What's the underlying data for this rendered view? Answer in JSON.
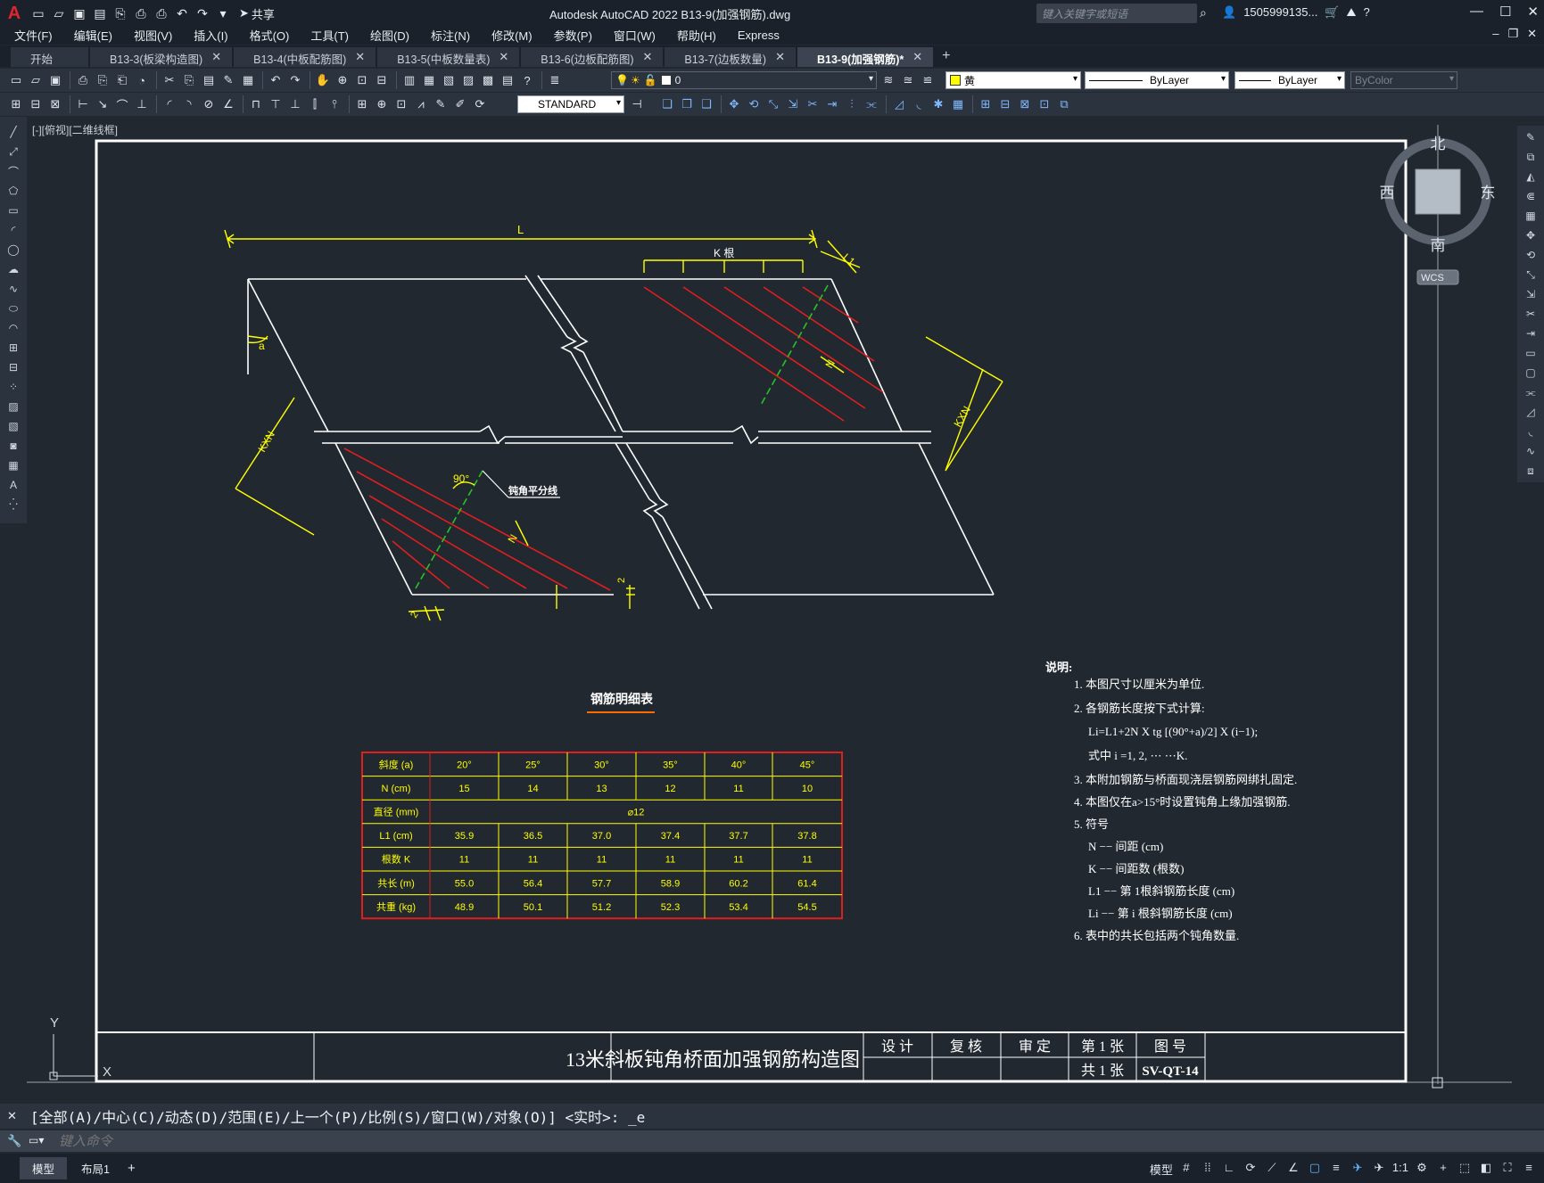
{
  "app": {
    "window_title": "Autodesk AutoCAD 2022    B13-9(加强钢筋).dwg",
    "share_label": "共享",
    "search_placeholder": "键入关键字或短语",
    "user": "1505999135...",
    "logo": "A"
  },
  "menu": [
    "文件(F)",
    "编辑(E)",
    "视图(V)",
    "插入(I)",
    "格式(O)",
    "工具(T)",
    "绘图(D)",
    "标注(N)",
    "修改(M)",
    "参数(P)",
    "窗口(W)",
    "帮助(H)",
    "Express"
  ],
  "tabs": [
    {
      "label": "开始",
      "closable": false,
      "active": false
    },
    {
      "label": "B13-3(板梁构造图)",
      "closable": true,
      "active": false
    },
    {
      "label": "B13-4(中板配筋图)",
      "closable": true,
      "active": false
    },
    {
      "label": "B13-5(中板数量表)",
      "closable": true,
      "active": false
    },
    {
      "label": "B13-6(边板配筋图)",
      "closable": true,
      "active": false
    },
    {
      "label": "B13-7(边板数量)",
      "closable": true,
      "active": false
    },
    {
      "label": "B13-9(加强钢筋)*",
      "closable": true,
      "active": true
    }
  ],
  "toolbar": {
    "layer_value": "0",
    "color_value": "黄",
    "color_hex": "#ffff00",
    "linetype_value": "ByLayer",
    "lineweight_value": "ByLayer",
    "plotstyle_value": "ByColor",
    "textstyle_value": "STANDARD"
  },
  "viewport_label": "[-][俯视][二维线框]",
  "viewcube": {
    "north": "北",
    "south": "南",
    "east": "东",
    "west": "西",
    "wcs": "WCS"
  },
  "ucs": {
    "x": "X",
    "y": "Y"
  },
  "drawing": {
    "dim_L": "L",
    "dim_K_spacing": "K 根",
    "dim_L1": "L1",
    "dim_KN_top": "KXN",
    "dim_KN_bottom": "KXN",
    "angle_a": "a",
    "angle_90": "90°",
    "label_N_top": "N",
    "label_N_bottom": "N",
    "label_2a": "2",
    "label_2b": "2",
    "bisector_label": "钝角平分线",
    "table_title": "钢筋明细表",
    "table": {
      "header": [
        "斜度 (a)",
        "20°",
        "25°",
        "30°",
        "35°",
        "40°",
        "45°"
      ],
      "rows": [
        [
          "N (cm)",
          "15",
          "14",
          "13",
          "12",
          "11",
          "10"
        ],
        [
          "直径 (mm)",
          "⌀12"
        ],
        [
          "L1 (cm)",
          "35.9",
          "36.5",
          "37.0",
          "37.4",
          "37.7",
          "37.8"
        ],
        [
          "根数 K",
          "11",
          "11",
          "11",
          "11",
          "11",
          "11"
        ],
        [
          "共长 (m)",
          "55.0",
          "56.4",
          "57.7",
          "58.9",
          "60.2",
          "61.4"
        ],
        [
          "共重 (kg)",
          "48.9",
          "50.1",
          "51.2",
          "52.3",
          "53.4",
          "54.5"
        ]
      ]
    },
    "notes_title": "说明:",
    "notes": [
      "1. 本图尺寸以厘米为单位.",
      "2. 各钢筋长度按下式计算:",
      "Li=L1+2N X tg [(90°+a)/2] X (i−1);",
      "式中 i =1, 2, ⋯ ⋯K.",
      "3. 本附加钢筋与桥面现浇层钢筋网绑扎固定.",
      "4. 本图仅在a>15°时设置钝角上缘加强钢筋.",
      "5. 符号",
      "N −−  间距 (cm)",
      "K −−  间距数 (根数)",
      "L1 −− 第 1根斜钢筋长度 (cm)",
      "Li −−  第 i 根斜钢筋长度 (cm)",
      "6. 表中的共长包括两个钝角数量."
    ],
    "title_block": {
      "title": "13米斜板钝角桥面加强钢筋构造图",
      "design": "设 计",
      "check": "复 核",
      "approve": "审 定",
      "sheet": "第 1 张",
      "total": "共 1 张",
      "drawing_no_label": "图 号",
      "drawing_no": "SV-QT-14"
    }
  },
  "command": {
    "history": "[全部(A)/中心(C)/动态(D)/范围(E)/上一个(P)/比例(S)/窗口(W)/对象(O)] <实时>: _e",
    "placeholder": "键入命令"
  },
  "status": {
    "model_tab": "模型",
    "layout_tab": "布局1",
    "model_label": "模型",
    "scale": "1:1"
  }
}
